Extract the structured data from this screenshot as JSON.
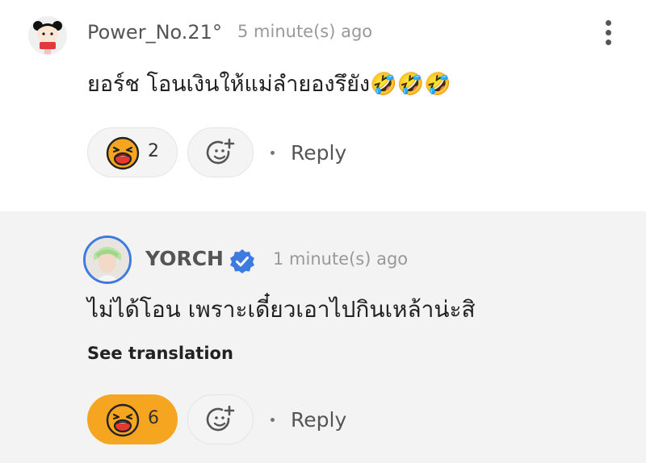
{
  "comment": {
    "username": "Power_No.21°",
    "timestamp": "5 minute(s) ago",
    "text": "ยอร์ช โอนเงินให้แม่ลำยองรึยัง🤣🤣🤣",
    "reaction_count": "2",
    "reply_label": "Reply",
    "more_icon": "more-vertical-icon"
  },
  "reply": {
    "username": "YORCH",
    "verified": true,
    "timestamp": "1 minute(s) ago",
    "text": "ไม่ได้โอน เพราะเดี๋ยวเอาไปกินเหล้าน่ะสิ",
    "see_translation_label": "See translation",
    "reaction_count": "6",
    "reply_label": "Reply"
  },
  "colors": {
    "accent_orange": "#f5a51f",
    "verified_blue": "#3d7be0",
    "reply_background": "#f3f3f3"
  },
  "icons": [
    "laughing-face-icon",
    "add-emoji-icon",
    "verified-badge-icon",
    "more-vertical-icon"
  ]
}
